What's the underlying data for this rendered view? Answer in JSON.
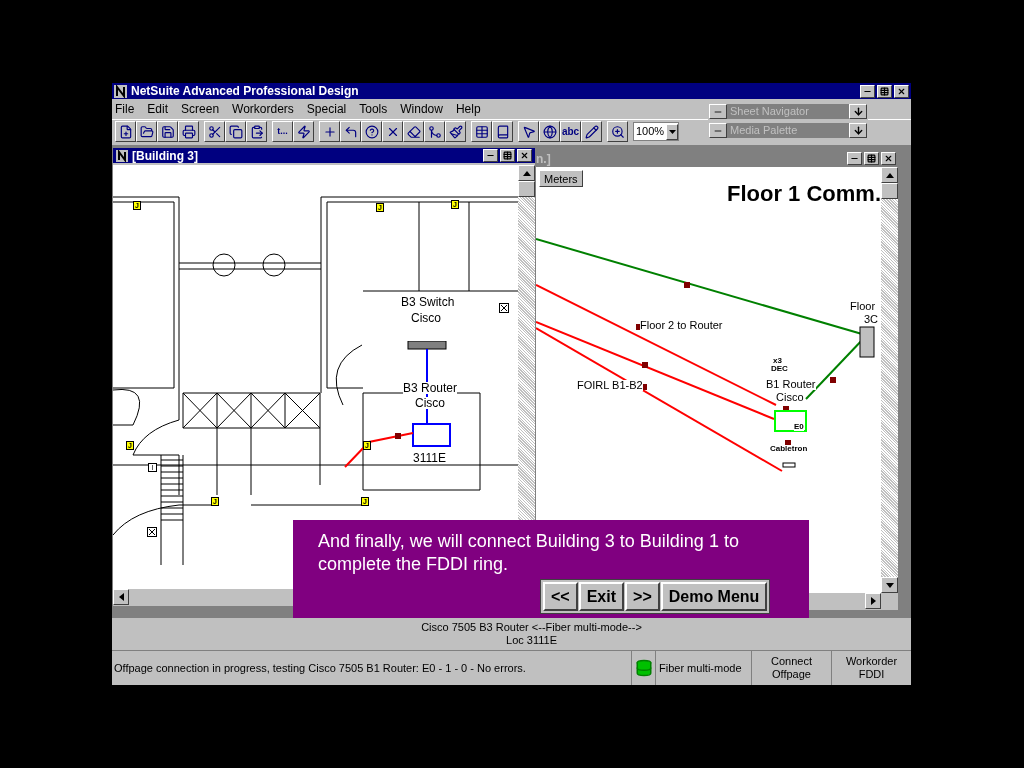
{
  "window": {
    "title": "NetSuite Advanced Professional Design"
  },
  "menu": [
    "File",
    "Edit",
    "Screen",
    "Workorders",
    "Special",
    "Tools",
    "Window",
    "Help"
  ],
  "toolbar": {
    "link_tool": "t...",
    "text_tool": "abc",
    "zoom": "100%"
  },
  "palettes": [
    {
      "title": "Sheet Navigator"
    },
    {
      "title": "Media Palette"
    }
  ],
  "left_window": {
    "title": "[Building 3]",
    "jacks": [
      "J",
      "J",
      "J",
      "J",
      "J",
      "J",
      "J"
    ],
    "outlet": "I",
    "labels": [
      "B3 Switch",
      "Cisco",
      "B3 Router",
      "Cisco",
      "3111E"
    ]
  },
  "right_window": {
    "title": "n.]",
    "tab": "Meters",
    "heading": "Floor 1 Comm.",
    "labels": [
      "Floor 2 to Router",
      "FOIRL B1-B2",
      "x3",
      "DEC",
      "B1 Router",
      "Cisco",
      "E0",
      "Cabletron",
      "Floor",
      "3C"
    ]
  },
  "tour": {
    "text": "And finally, we will connect Building 3 to Building 1 to complete the FDDI ring.",
    "buttons": [
      "<<",
      "Exit",
      ">>",
      "Demo Menu"
    ]
  },
  "info": [
    "Cisco 7505 B3 Router <--Fiber multi-mode-->",
    "Loc 3111E"
  ],
  "status_bar": {
    "message": "Offpage connection in progress, testing Cisco 7505 B1 Router: E0 - 1 - 0 - No errors.",
    "medium": "Fiber multi-mode",
    "fields": [
      [
        "Connect",
        "Offpage"
      ],
      [
        "Workorder",
        "FDDI"
      ]
    ]
  }
}
